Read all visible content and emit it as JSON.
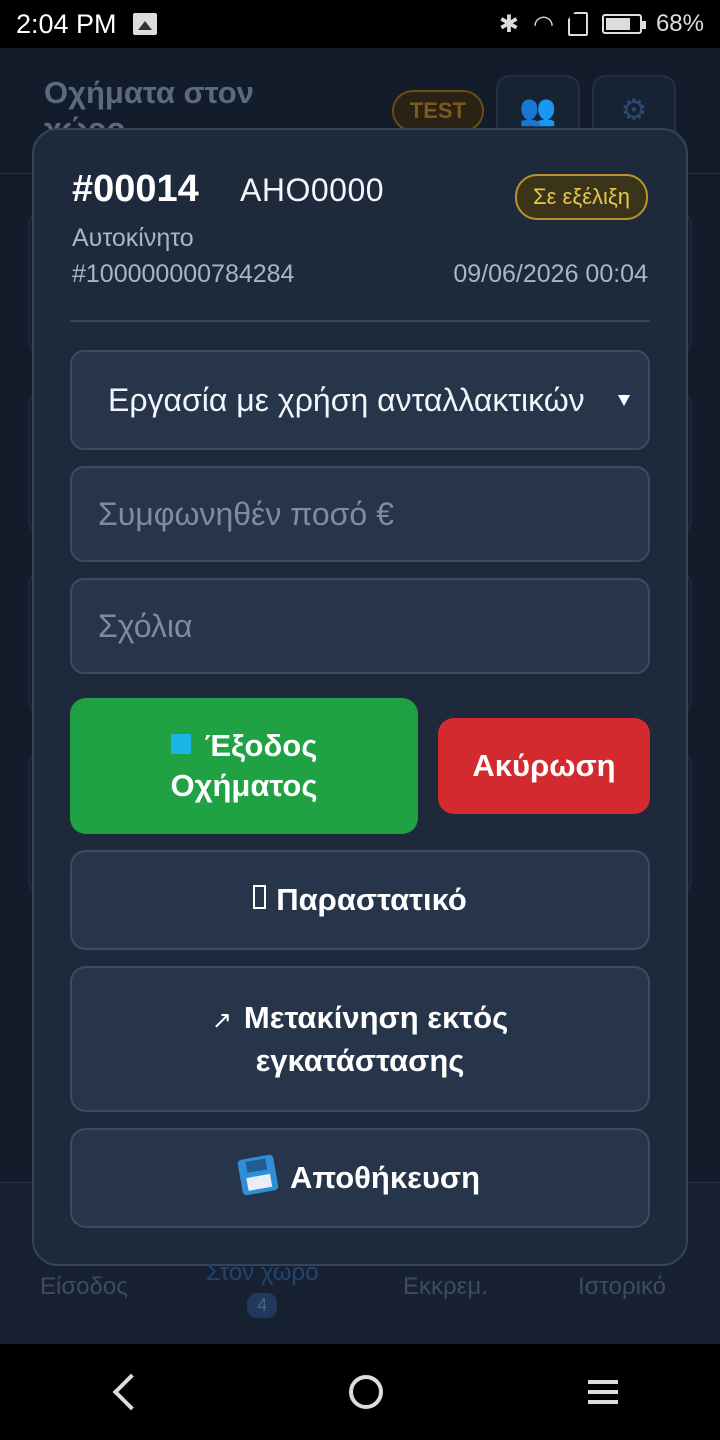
{
  "status_bar": {
    "time": "2:04 PM",
    "battery": "68%"
  },
  "background_app": {
    "title": "Οχήματα στον χώρο",
    "env_badge": "TEST",
    "nav": [
      {
        "label": "Είσοδος"
      },
      {
        "label": "Στον χώρο",
        "count": "4"
      },
      {
        "label": "Εκκρεμ."
      },
      {
        "label": "Ιστορικό"
      }
    ]
  },
  "modal": {
    "ticket_number": "#00014",
    "plate": "ΑΗΟ0000",
    "status": "Σε εξέλιξη",
    "vehicle_type": "Αυτοκίνητο",
    "vehicle_id": "#100000000784284",
    "datetime": "09/06/2026 00:04",
    "work_type_selected": "Εργασία με χρήση ανταλλακτικών",
    "amount_placeholder": "Συμφωνηθέν ποσό €",
    "comments_placeholder": "Σχόλια",
    "exit_button_line1": "Έξοδος",
    "exit_button_line2": "Οχήματος",
    "cancel_button": "Ακύρωση",
    "document_button": "Παραστατικό",
    "move_button_line1": "Μετακίνηση εκτός",
    "move_button_line2": "εγκατάστασης",
    "save_button": "Αποθήκευση"
  },
  "colors": {
    "exit_green": "#20a244",
    "cancel_red": "#d22a2f",
    "status_gold": "#e9c650"
  }
}
